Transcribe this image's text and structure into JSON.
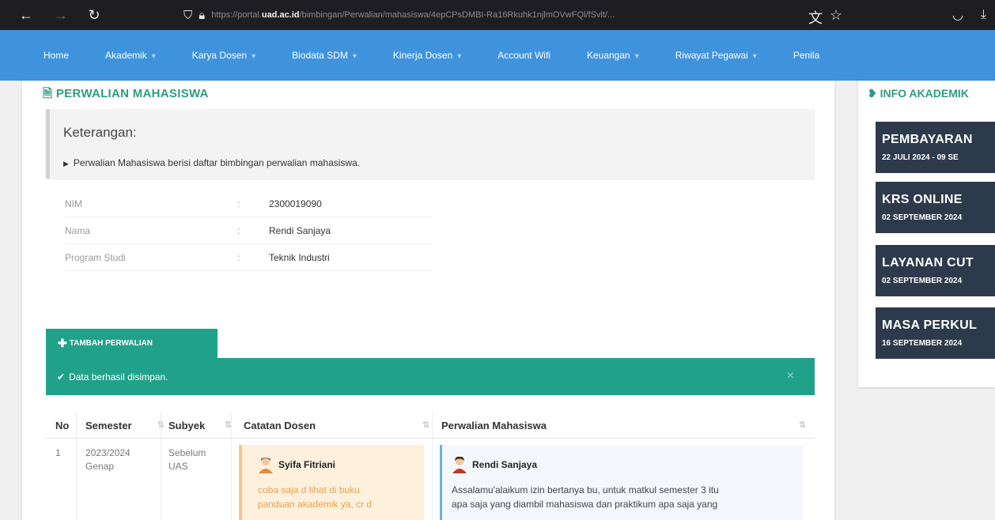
{
  "browser": {
    "url_prefix": "https://portal.",
    "url_host": "uad.ac.id",
    "url_path": "/bimbingan/Perwalian/mahasiswa/4epCPsDMBI-Ra16Rkuhk1njlmOVwFQl/fSvlt/..."
  },
  "nav": {
    "items": [
      {
        "label": "Home",
        "caret": false
      },
      {
        "label": "Akademik",
        "caret": true
      },
      {
        "label": "Karya Dosen",
        "caret": true
      },
      {
        "label": "Biodata SDM",
        "caret": true
      },
      {
        "label": "Kinerja Dosen",
        "caret": true
      },
      {
        "label": "Account Wifi",
        "caret": false
      },
      {
        "label": "Keuangan",
        "caret": true
      },
      {
        "label": "Riwayat Pegawai",
        "caret": true
      },
      {
        "label": "Penila",
        "caret": false
      }
    ]
  },
  "page": {
    "title": "PERWALIAN MAHASISWA",
    "info_title": "Keterangan:",
    "info_text": "Perwalian Mahasiswa berisi daftar bimbingan perwalian mahasiswa."
  },
  "details": [
    {
      "label": "NIM",
      "value": "2300019090"
    },
    {
      "label": "Nama",
      "value": "Rendi Sanjaya"
    },
    {
      "label": "Program Studi",
      "value": "Teknik Industri"
    }
  ],
  "actions": {
    "add_button": "TAMBAH PERWALIAN",
    "alert_text": "Data berhasil disimpan.",
    "alert_close": "×"
  },
  "table": {
    "headers": [
      "No",
      "Semester",
      "Subyek",
      "Catatan Dosen",
      "Perwalian Mahasiswa"
    ],
    "row": {
      "no": "1",
      "semester_1": "2023/2024",
      "semester_2": "Genap",
      "subyek_1": "Sebelum",
      "subyek_2": "UAS",
      "dosen_name": "Syifa Fitriani",
      "dosen_note_1": "coba saja d lihat di buku",
      "dosen_note_2": "panduan akademik ya, cr d",
      "mhs_name": "Rendi Sanjaya",
      "mhs_note_1": "Assalamu'alaikum izin bertanya bu, untuk matkul semester 3 itu",
      "mhs_note_2": "apa saja yang diambil mahasiswa dan praktikum apa saja yang"
    }
  },
  "sidebar": {
    "title": "INFO AKADEMIK",
    "items": [
      {
        "title": "PEMBAYARAN",
        "date": "22 JULI 2024 - 09 SE"
      },
      {
        "title": "KRS ONLINE",
        "date": "02 SEPTEMBER 2024"
      },
      {
        "title": "LAYANAN CUT",
        "date": "02 SEPTEMBER 2024"
      },
      {
        "title": "MASA PERKUL",
        "date": "16 SEPTEMBER 2024"
      }
    ]
  }
}
